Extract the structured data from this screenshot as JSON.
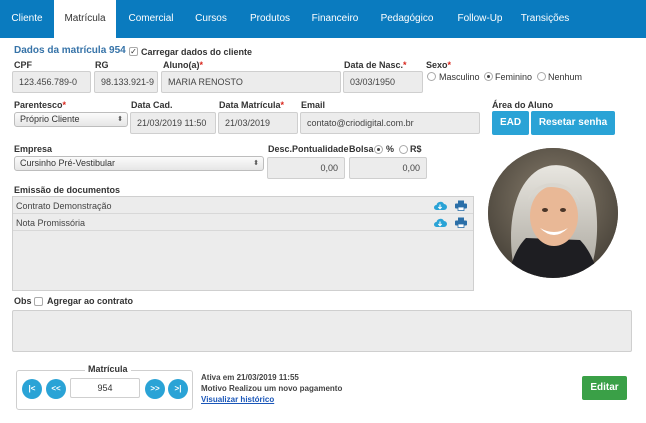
{
  "nav": {
    "tabs": [
      "Cliente",
      "Matrícula",
      "Comercial",
      "Cursos",
      "Produtos",
      "Financeiro",
      "Pedagógico",
      "Follow-Up",
      "Transições"
    ],
    "active": "Matrícula"
  },
  "header": {
    "title": "Dados da matrícula 954",
    "load_client_label": "Carregar dados do cliente",
    "load_client_checked": true
  },
  "fields": {
    "cpf": {
      "label": "CPF",
      "value": "123.456.789-0"
    },
    "rg": {
      "label": "RG",
      "value": "98.133.921-9"
    },
    "aluno": {
      "label": "Aluno(a)",
      "value": "MARIA RENOSTO"
    },
    "data_nasc": {
      "label": "Data de Nasc.",
      "value": "03/03/1950"
    },
    "sexo": {
      "label": "Sexo",
      "options": [
        "Masculino",
        "Feminino",
        "Nenhum"
      ],
      "selected": "Feminino"
    },
    "parentesco": {
      "label": "Parentesco",
      "value": "Próprio Cliente"
    },
    "data_cad": {
      "label": "Data Cad.",
      "value": "21/03/2019 11:50"
    },
    "data_matricula": {
      "label": "Data Matrícula",
      "value": "21/03/2019"
    },
    "email": {
      "label": "Email",
      "value": "contato@criodigital.com.br"
    },
    "empresa": {
      "label": "Empresa",
      "value": "Cursinho Pré-Vestibular"
    },
    "desc_pontualidade": {
      "label": "Desc.Pontualidade",
      "value": "0,00"
    },
    "bolsa": {
      "label": "Bolsa",
      "options": [
        "%",
        "R$"
      ],
      "selected": "%",
      "value": "0,00"
    }
  },
  "area_aluno": {
    "label": "Área do Aluno",
    "ead_button": "EAD",
    "reset_button": "Resetar senha"
  },
  "documentos": {
    "label": "Emissão de documentos",
    "rows": [
      "Contrato Demonstração",
      "Nota Promissória"
    ]
  },
  "obs": {
    "label": "Obs",
    "agregar_label": "Agregar ao contrato",
    "agregar_checked": false
  },
  "matricula_nav": {
    "legend": "Matrícula",
    "number": "954",
    "first": "|<",
    "prev": "<<",
    "next": ">>",
    "last": ">|"
  },
  "status": {
    "line1": "Ativa em 21/03/2019 11:55",
    "line2": "Motivo Realizou um novo pagamento",
    "link": "Visualizar histórico"
  },
  "actions": {
    "edit_button": "Editar"
  },
  "colors": {
    "nav_bg": "#0a7bbf",
    "title": "#3673a8",
    "button_blue": "#2aa3d6",
    "button_green": "#3aa047",
    "required": "#d9261c"
  }
}
